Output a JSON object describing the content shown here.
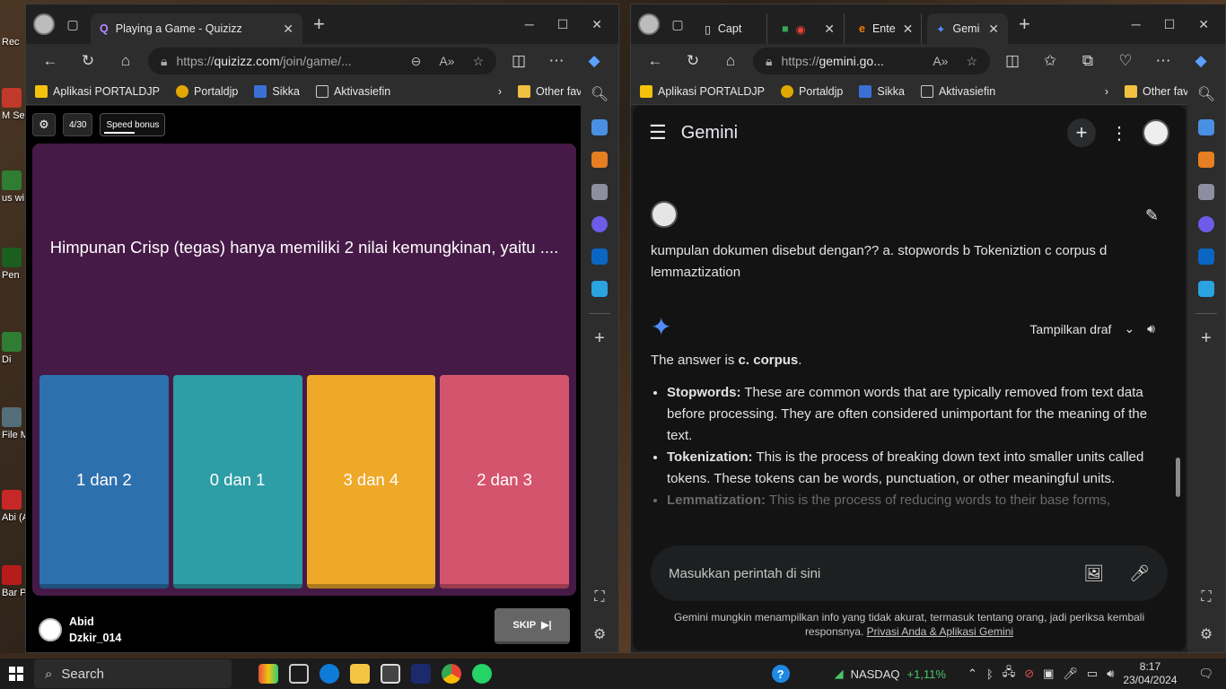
{
  "desktop": {
    "icons": [
      "Rec",
      "M Secu",
      "us wi",
      "Pen",
      "Di",
      "File Me",
      "Abi (Abi",
      "Bar PC"
    ]
  },
  "quiz_window": {
    "tab_title": "Playing a Game - Quizizz",
    "url_prefix": "https://",
    "url_domain": "quizizz.com",
    "url_rest": "/join/game/...",
    "favorites": [
      "Aplikasi PORTALDJP",
      "Portaldjp",
      "Sikka",
      "Aktivasiefin"
    ],
    "other_favorites": "Other favorites",
    "progress": "4/30",
    "speed_bonus": "Speed bonus",
    "question": "Himpunan Crisp (tegas) hanya memiliki 2 nilai kemungkinan, yaitu ....",
    "options": [
      {
        "label": "1 dan 2",
        "color": "#2d70ae"
      },
      {
        "label": "0 dan 1",
        "color": "#2d9da6"
      },
      {
        "label": "3 dan 4",
        "color": "#efa929"
      },
      {
        "label": "2 dan 3",
        "color": "#d5546d"
      }
    ],
    "player_first": "Abid",
    "player_last": "Dzkir_014",
    "skip_label": "SKIP"
  },
  "gemini_window": {
    "tabs": [
      "Capt",
      "",
      "Ente",
      "Gemi"
    ],
    "url_prefix": "https://",
    "url_domain": "gemini.go...",
    "favorites": [
      "Aplikasi PORTALDJP",
      "Portaldjp",
      "Sikka",
      "Aktivasiefin"
    ],
    "other_favorites": "Other favorites",
    "app_title": "Gemini",
    "user_message": "kumpulan dokumen disebut dengan?? a. stopwords b Tokeniztion c corpus d lemmaztization",
    "show_drafts": "Tampilkan draf",
    "answer_prefix": "The answer is ",
    "answer_bold": "c. corpus",
    "answer_suffix": ".",
    "bullets": [
      {
        "term": "Stopwords:",
        "text": " These are common words that are typically removed from text data before processing. They are often considered unimportant for the meaning of the text."
      },
      {
        "term": "Tokenization:",
        "text": " This is the process of breaking down text into smaller units called tokens. These tokens can be words, punctuation, or other meaningful units."
      },
      {
        "term": "Lemmatization:",
        "text": " This is the process of reducing words to their base forms,"
      }
    ],
    "input_placeholder": "Masukkan perintah di sini",
    "disclaimer": "Gemini mungkin menampilkan info yang tidak akurat, termasuk tentang orang, jadi periksa kembali responsnya.",
    "privacy_link": "Privasi Anda & Aplikasi Gemini"
  },
  "taskbar": {
    "search": "Search",
    "stock_name": "NASDAQ",
    "stock_change": "+1,11%",
    "time": "8:17",
    "date": "23/04/2024"
  },
  "colors": {
    "quiz_card": "#461a47",
    "gemini_bg": "#131314",
    "accent": "#4f8cf7"
  }
}
